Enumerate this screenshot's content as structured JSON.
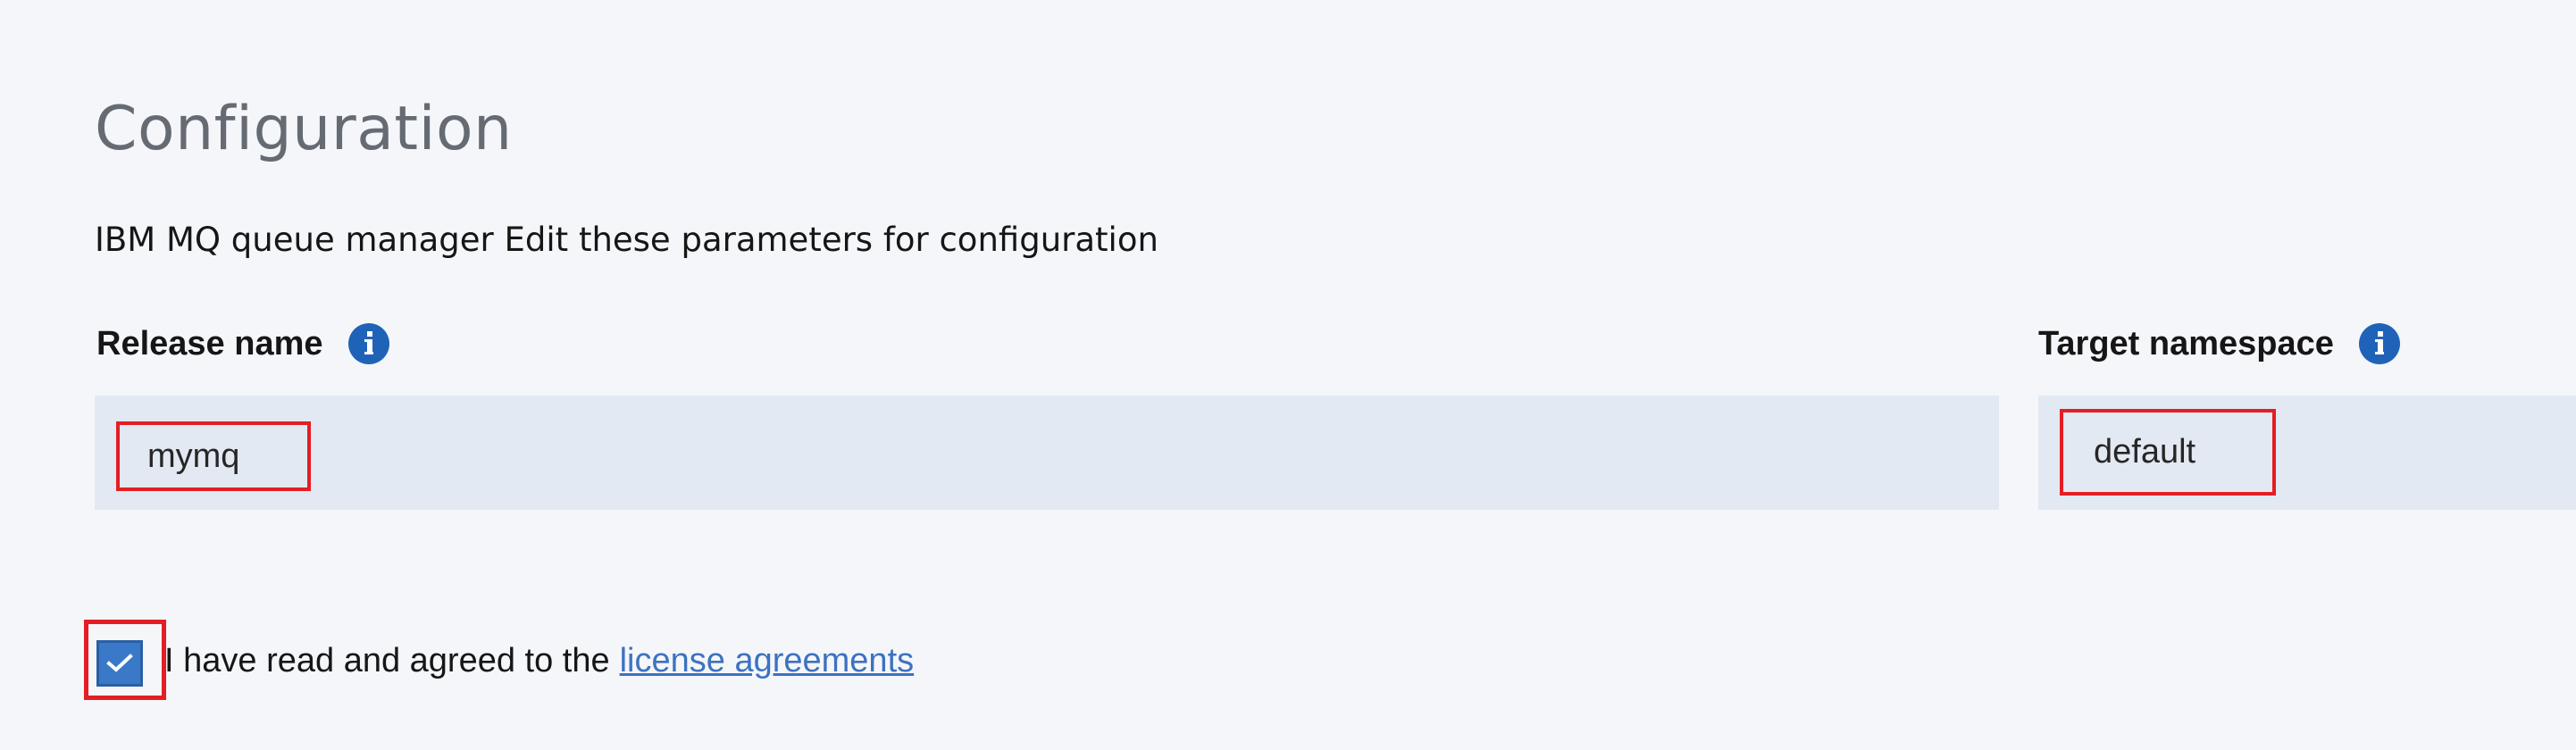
{
  "page": {
    "title": "Configuration",
    "description": "IBM MQ queue manager Edit these parameters for configuration"
  },
  "fields": {
    "release_name": {
      "label": "Release name",
      "value": "mymq"
    },
    "target_namespace": {
      "label": "Target namespace",
      "value": "default"
    }
  },
  "license": {
    "checked": true,
    "text": "I have read and agreed to the",
    "link_text": "license agreements"
  },
  "colors": {
    "background": "#f4f6fa",
    "input_background": "#e3e9f2",
    "info_icon": "#1f63b8",
    "checkbox": "#3a78c8",
    "link": "#3d72c0",
    "highlight_border": "#e31e24"
  },
  "icons": {
    "info": "info-icon",
    "check": "checkmark-icon"
  }
}
